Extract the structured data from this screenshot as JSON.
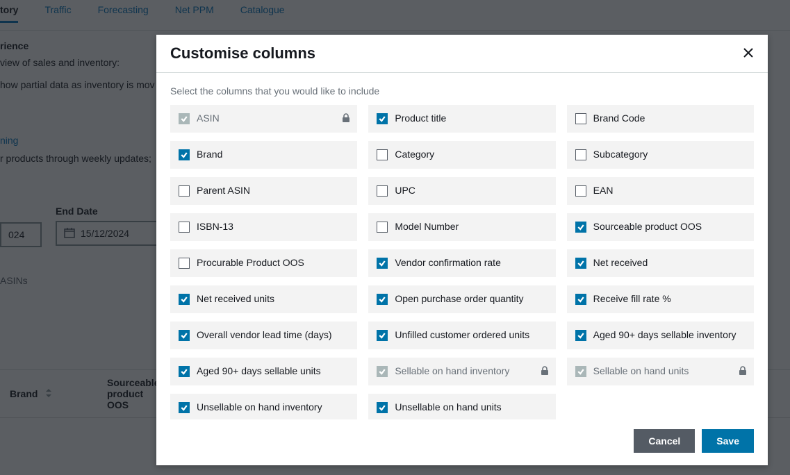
{
  "bg": {
    "tabs": [
      "tory",
      "Traffic",
      "Forecasting",
      "Net PPM",
      "Catalogue"
    ],
    "active_tab_index": 0,
    "heading1": "rience",
    "text1": "view of sales and inventory:",
    "text2": "how partial data as inventory is mov",
    "link1": "ning",
    "text3": "r products through weekly updates;",
    "enddate_label": "End Date",
    "date1": "024",
    "date2": "15/12/2024",
    "asins": "ASINs",
    "th_brand": "Brand",
    "th_oos": "Sourceable product OOS"
  },
  "modal": {
    "title": "Customise columns",
    "instructions": "Select the columns that you would like to include",
    "cancel": "Cancel",
    "save": "Save",
    "columns": [
      {
        "label": "ASIN",
        "checked": true,
        "locked": true
      },
      {
        "label": "Product title",
        "checked": true,
        "locked": false
      },
      {
        "label": "Brand Code",
        "checked": false,
        "locked": false
      },
      {
        "label": "Brand",
        "checked": true,
        "locked": false
      },
      {
        "label": "Category",
        "checked": false,
        "locked": false
      },
      {
        "label": "Subcategory",
        "checked": false,
        "locked": false
      },
      {
        "label": "Parent ASIN",
        "checked": false,
        "locked": false
      },
      {
        "label": "UPC",
        "checked": false,
        "locked": false
      },
      {
        "label": "EAN",
        "checked": false,
        "locked": false
      },
      {
        "label": "ISBN-13",
        "checked": false,
        "locked": false
      },
      {
        "label": "Model Number",
        "checked": false,
        "locked": false
      },
      {
        "label": "Sourceable product OOS",
        "checked": true,
        "locked": false
      },
      {
        "label": "Procurable Product OOS",
        "checked": false,
        "locked": false
      },
      {
        "label": "Vendor confirmation rate",
        "checked": true,
        "locked": false
      },
      {
        "label": "Net received",
        "checked": true,
        "locked": false
      },
      {
        "label": "Net received units",
        "checked": true,
        "locked": false
      },
      {
        "label": "Open purchase order quantity",
        "checked": true,
        "locked": false
      },
      {
        "label": "Receive fill rate %",
        "checked": true,
        "locked": false
      },
      {
        "label": "Overall vendor lead time (days)",
        "checked": true,
        "locked": false
      },
      {
        "label": "Unfilled customer ordered units",
        "checked": true,
        "locked": false
      },
      {
        "label": "Aged 90+ days sellable inventory",
        "checked": true,
        "locked": false
      },
      {
        "label": "Aged 90+ days sellable units",
        "checked": true,
        "locked": false
      },
      {
        "label": "Sellable on hand inventory",
        "checked": true,
        "locked": true
      },
      {
        "label": "Sellable on hand units",
        "checked": true,
        "locked": true
      },
      {
        "label": "Unsellable on hand inventory",
        "checked": true,
        "locked": false
      },
      {
        "label": "Unsellable on hand units",
        "checked": true,
        "locked": false
      }
    ]
  }
}
